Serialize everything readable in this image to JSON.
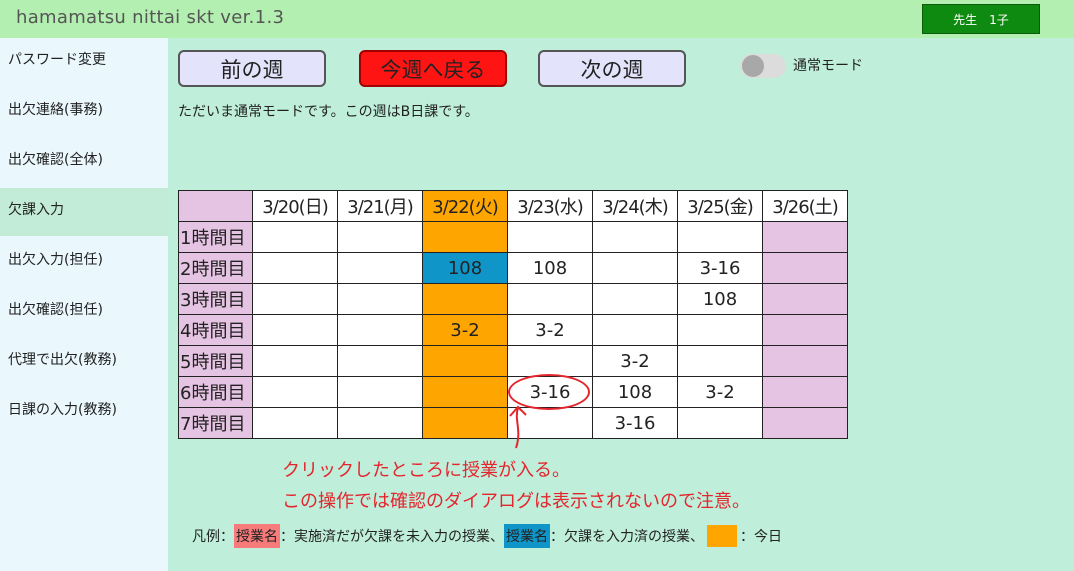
{
  "app": {
    "title": "hamamatsu nittai skt ver.1.3",
    "user": "先生　1子"
  },
  "sidebar": {
    "items": [
      {
        "label": "パスワード変更"
      },
      {
        "label": "出欠連絡(事務)"
      },
      {
        "label": "出欠確認(全体)"
      },
      {
        "label": "欠課入力",
        "active": true
      },
      {
        "label": "出欠入力(担任)"
      },
      {
        "label": "出欠確認(担任)"
      },
      {
        "label": "代理で出欠(教務)"
      },
      {
        "label": "日課の入力(教務)"
      }
    ]
  },
  "nav": {
    "prev_label": "前の週",
    "today_label": "今週へ戻る",
    "next_label": "次の週",
    "mode_label": "通常モード",
    "status": "ただいま通常モードです。この週はB日課です。"
  },
  "schedule": {
    "columns": [
      "3/20(日)",
      "3/21(月)",
      "3/22(火)",
      "3/23(水)",
      "3/24(木)",
      "3/25(金)",
      "3/26(土)"
    ],
    "rows": [
      {
        "label": "1時間目",
        "cells": [
          "",
          "",
          "",
          "",
          "",
          "",
          ""
        ]
      },
      {
        "label": "2時間目",
        "cells": [
          "",
          "",
          "108",
          "108",
          "",
          "3-16",
          ""
        ]
      },
      {
        "label": "3時間目",
        "cells": [
          "",
          "",
          "",
          "",
          "",
          "108",
          ""
        ]
      },
      {
        "label": "4時間目",
        "cells": [
          "",
          "",
          "3-2",
          "3-2",
          "",
          "",
          ""
        ]
      },
      {
        "label": "5時間目",
        "cells": [
          "",
          "",
          "",
          "",
          "3-2",
          "",
          ""
        ]
      },
      {
        "label": "6時間目",
        "cells": [
          "",
          "",
          "",
          "3-16",
          "108",
          "3-2",
          ""
        ]
      },
      {
        "label": "7時間目",
        "cells": [
          "",
          "",
          "",
          "",
          "3-16",
          "",
          ""
        ]
      }
    ]
  },
  "annotation": {
    "line1": "クリックしたところに授業が入る。",
    "line2": "この操作では確認のダイアログは表示されないので注意。"
  },
  "legend": {
    "prefix": "凡例：",
    "red_chip": "授業名",
    "red_desc": "：実施済だが欠課を未入力の授業、",
    "blue_chip": "授業名",
    "blue_desc": "：欠課を入力済の授業、",
    "orange_desc": "：今日"
  },
  "colors": {
    "today": "#ffa500",
    "saturday": "#e5c3e2",
    "entered": "#0f95c7",
    "not_entered": "#f77b7b",
    "annotation": "#e3262c",
    "header_bar": "#b3efb0"
  }
}
